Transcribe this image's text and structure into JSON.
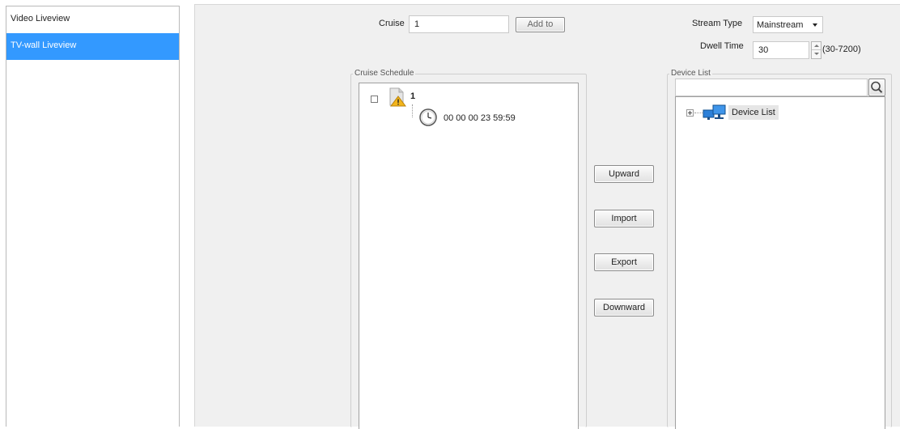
{
  "sidebar": {
    "items": [
      {
        "label": "Video Liveview"
      },
      {
        "label": "TV-wall Liveview"
      }
    ]
  },
  "cruise": {
    "label": "Cruise",
    "value": "1",
    "add_button": "Add to"
  },
  "stream": {
    "label": "Stream Type",
    "value": "Mainstream"
  },
  "dwell": {
    "label": "Dwell Time",
    "value": "30",
    "range": "(30-7200)"
  },
  "schedule": {
    "legend": "Cruise Schedule",
    "node_label": "1",
    "time_entry": "00 00 00 23 59:59"
  },
  "actions": {
    "upward": "Upward",
    "import": "Import",
    "export": "Export",
    "downward": "Downward"
  },
  "device_list": {
    "legend": "Device List",
    "search_placeholder": "",
    "root_label": "Device List"
  }
}
